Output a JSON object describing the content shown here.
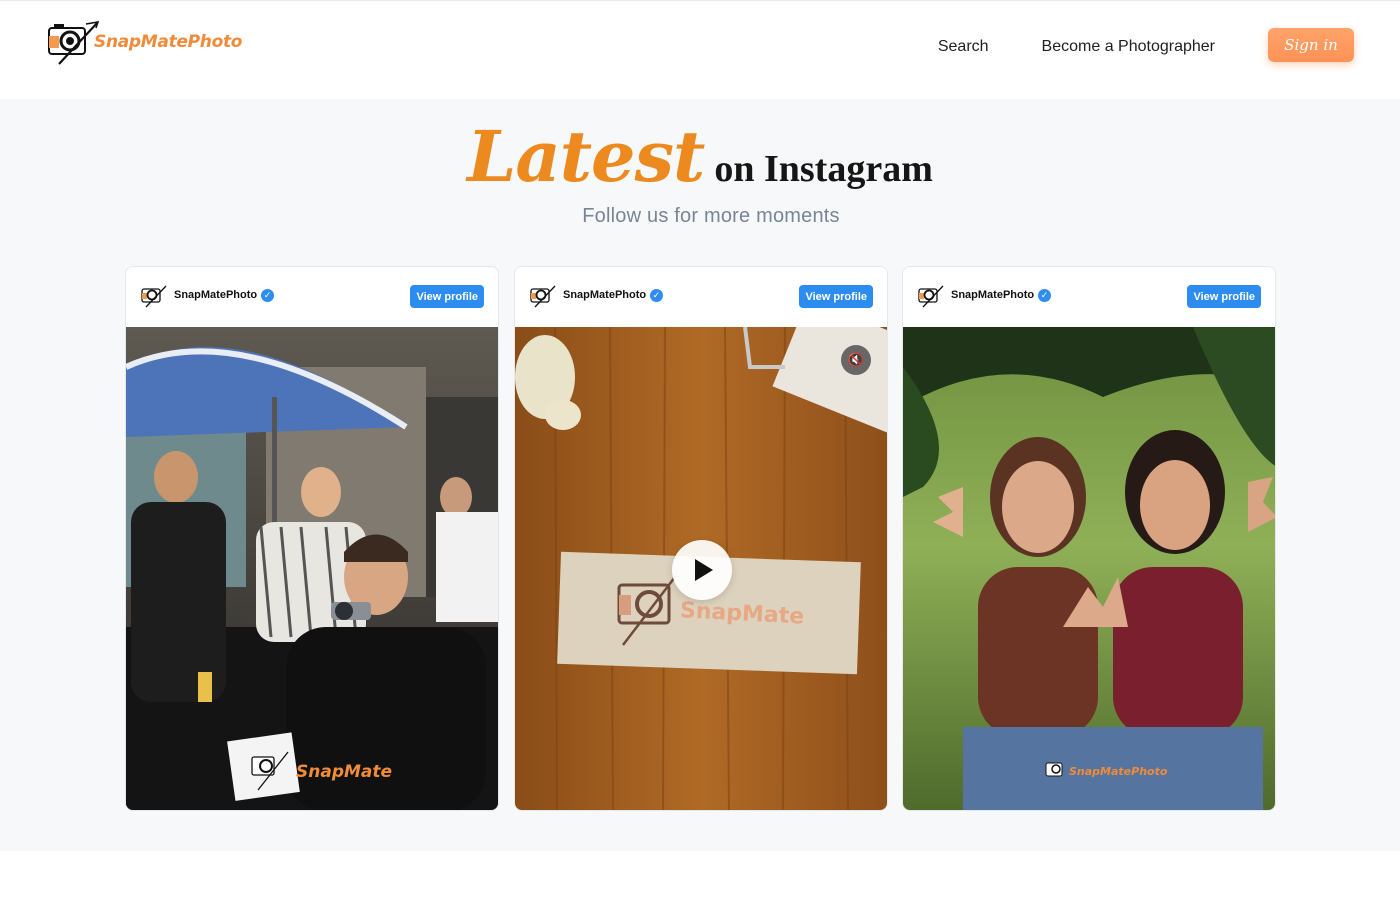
{
  "header": {
    "brand": "SnapMatePhoto",
    "nav": {
      "search": "Search",
      "become": "Become a Photographer",
      "signin": "Sign in"
    }
  },
  "section": {
    "title_accent": "Latest",
    "title_rest": "on Instagram",
    "subtitle": "Follow us for more moments"
  },
  "posts": [
    {
      "account": "SnapMatePhoto",
      "view_label": "View profile",
      "watermark": "SnapMate",
      "media": "photo"
    },
    {
      "account": "SnapMatePhoto",
      "view_label": "View profile",
      "watermark": "SnapMate",
      "media": "video"
    },
    {
      "account": "SnapMatePhoto",
      "view_label": "View profile",
      "watermark": "SnapMatePhoto",
      "media": "photo"
    }
  ],
  "colors": {
    "brand_orange": "#f08b3a",
    "title_accent": "#ec8a1f",
    "signin_bg": "#ff9a5e",
    "view_button": "#2d8cf0",
    "verified": "#2f8cf0",
    "section_bg": "#f7f8fa"
  },
  "icons": [
    "camera-logo-icon",
    "verified-badge-icon",
    "play-icon",
    "mute-icon"
  ]
}
